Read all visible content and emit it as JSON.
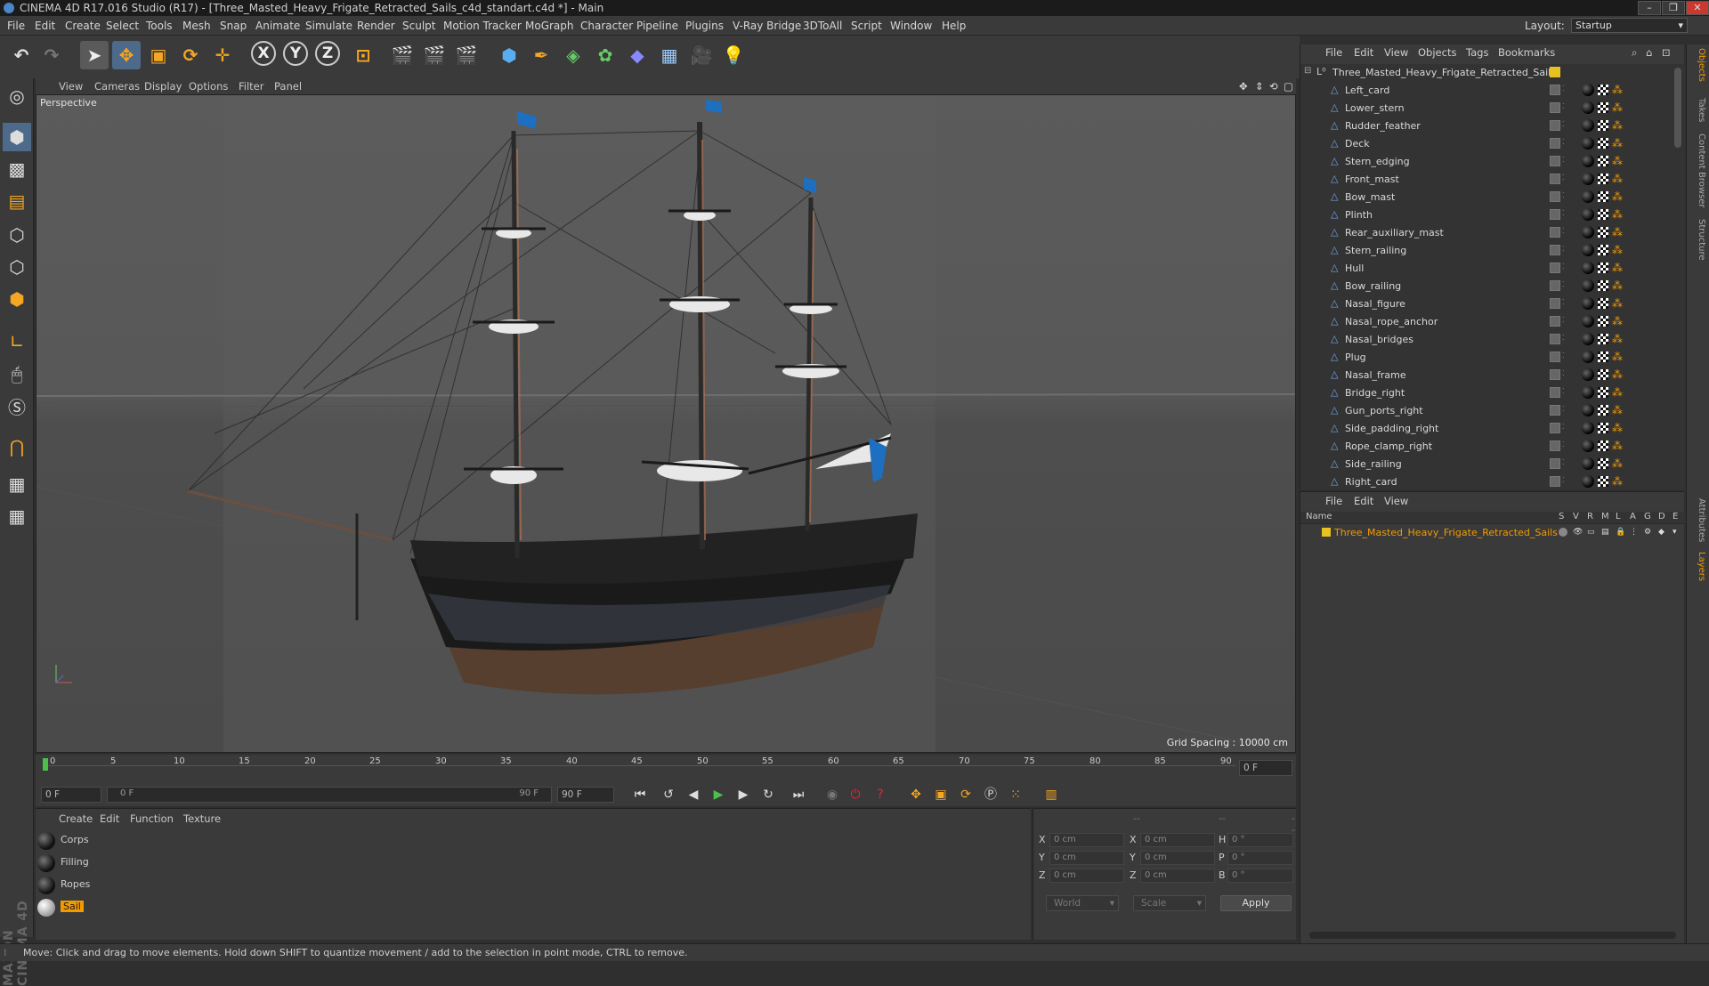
{
  "window": {
    "title": "CINEMA 4D R17.016 Studio (R17) - [Three_Masted_Heavy_Frigate_Retracted_Sails_c4d_standart.c4d *] - Main",
    "controls": [
      "–",
      "❐",
      "✕"
    ]
  },
  "menubar": {
    "items": [
      "File",
      "Edit",
      "Create",
      "Select",
      "Tools",
      "Mesh",
      "Snap",
      "Animate",
      "Simulate",
      "Render",
      "Sculpt",
      "Motion Tracker",
      "MoGraph",
      "Character",
      "Pipeline",
      "Plugins",
      "V-Ray Bridge",
      "3DToAll",
      "Script",
      "Window",
      "Help"
    ],
    "layout_label": "Layout:",
    "layout_value": "Startup"
  },
  "toolbar": {
    "axis_x": "X",
    "axis_y": "Y",
    "axis_z": "Z"
  },
  "viewport": {
    "menu": [
      "View",
      "Cameras",
      "Display",
      "Options",
      "Filter",
      "Panel"
    ],
    "label": "Perspective",
    "grid_spacing": "Grid Spacing : 10000 cm"
  },
  "timeline": {
    "ticks": [
      "0",
      "5",
      "10",
      "15",
      "20",
      "25",
      "30",
      "35",
      "40",
      "45",
      "50",
      "55",
      "60",
      "65",
      "70",
      "75",
      "80",
      "85",
      "90"
    ],
    "current_frame": "0 F",
    "start_field": "0 F",
    "range_start": "0 F",
    "range_end": "90 F",
    "end_field": "90 F"
  },
  "material_manager": {
    "menu": [
      "Create",
      "Edit",
      "Function",
      "Texture"
    ],
    "materials": [
      {
        "name": "Corps",
        "selected": false
      },
      {
        "name": "Filling",
        "selected": false
      },
      {
        "name": "Ropes",
        "selected": false
      },
      {
        "name": "Sail",
        "selected": true
      }
    ]
  },
  "coordinates": {
    "headers": [
      "--",
      "--",
      "--"
    ],
    "rows": [
      {
        "l1": "X",
        "v1": "0 cm",
        "l2": "X",
        "v2": "0 cm",
        "l3": "H",
        "v3": "0 °"
      },
      {
        "l1": "Y",
        "v1": "0 cm",
        "l2": "Y",
        "v2": "0 cm",
        "l3": "P",
        "v3": "0 °"
      },
      {
        "l1": "Z",
        "v1": "0 cm",
        "l2": "Z",
        "v2": "0 cm",
        "l3": "B",
        "v3": "0 °"
      }
    ],
    "mode": "World",
    "transform": "Scale",
    "apply": "Apply"
  },
  "object_manager": {
    "menu": [
      "File",
      "Edit",
      "View",
      "Objects",
      "Tags",
      "Bookmarks"
    ],
    "root": "Three_Masted_Heavy_Frigate_Retracted_Sails",
    "objects": [
      "Left_card",
      "Lower_stern",
      "Rudder_feather",
      "Deck",
      "Stern_edging",
      "Front_mast",
      "Bow_mast",
      "Plinth",
      "Rear_auxiliary_mast",
      "Stern_railing",
      "Hull",
      "Bow_railing",
      "Nasal_figure",
      "Nasal_rope_anchor",
      "Nasal_bridges",
      "Plug",
      "Nasal_frame",
      "Bridge_right",
      "Gun_ports_right",
      "Side_padding_right",
      "Rope_clamp_right",
      "Side_railing",
      "Right_card"
    ]
  },
  "layer_manager": {
    "menu": [
      "File",
      "Edit",
      "View"
    ],
    "columns": [
      "Name",
      "S",
      "V",
      "R",
      "M",
      "L",
      "A",
      "G",
      "D",
      "E"
    ],
    "layer_name": "Three_Masted_Heavy_Frigate_Retracted_Sails",
    "layer_color": "#e8c020"
  },
  "right_tabs": [
    "Objects",
    "Takes",
    "Content Browser",
    "Structure",
    "Attributes",
    "Layers"
  ],
  "status": "Move: Click and drag to move elements. Hold down SHIFT to quantize movement / add to the selection in point mode, CTRL to remove.",
  "brand": "MAXON CINEMA 4D",
  "colors": {
    "accent": "#f29a00",
    "flag": "#1e6fc0",
    "layer": "#e8c020"
  }
}
